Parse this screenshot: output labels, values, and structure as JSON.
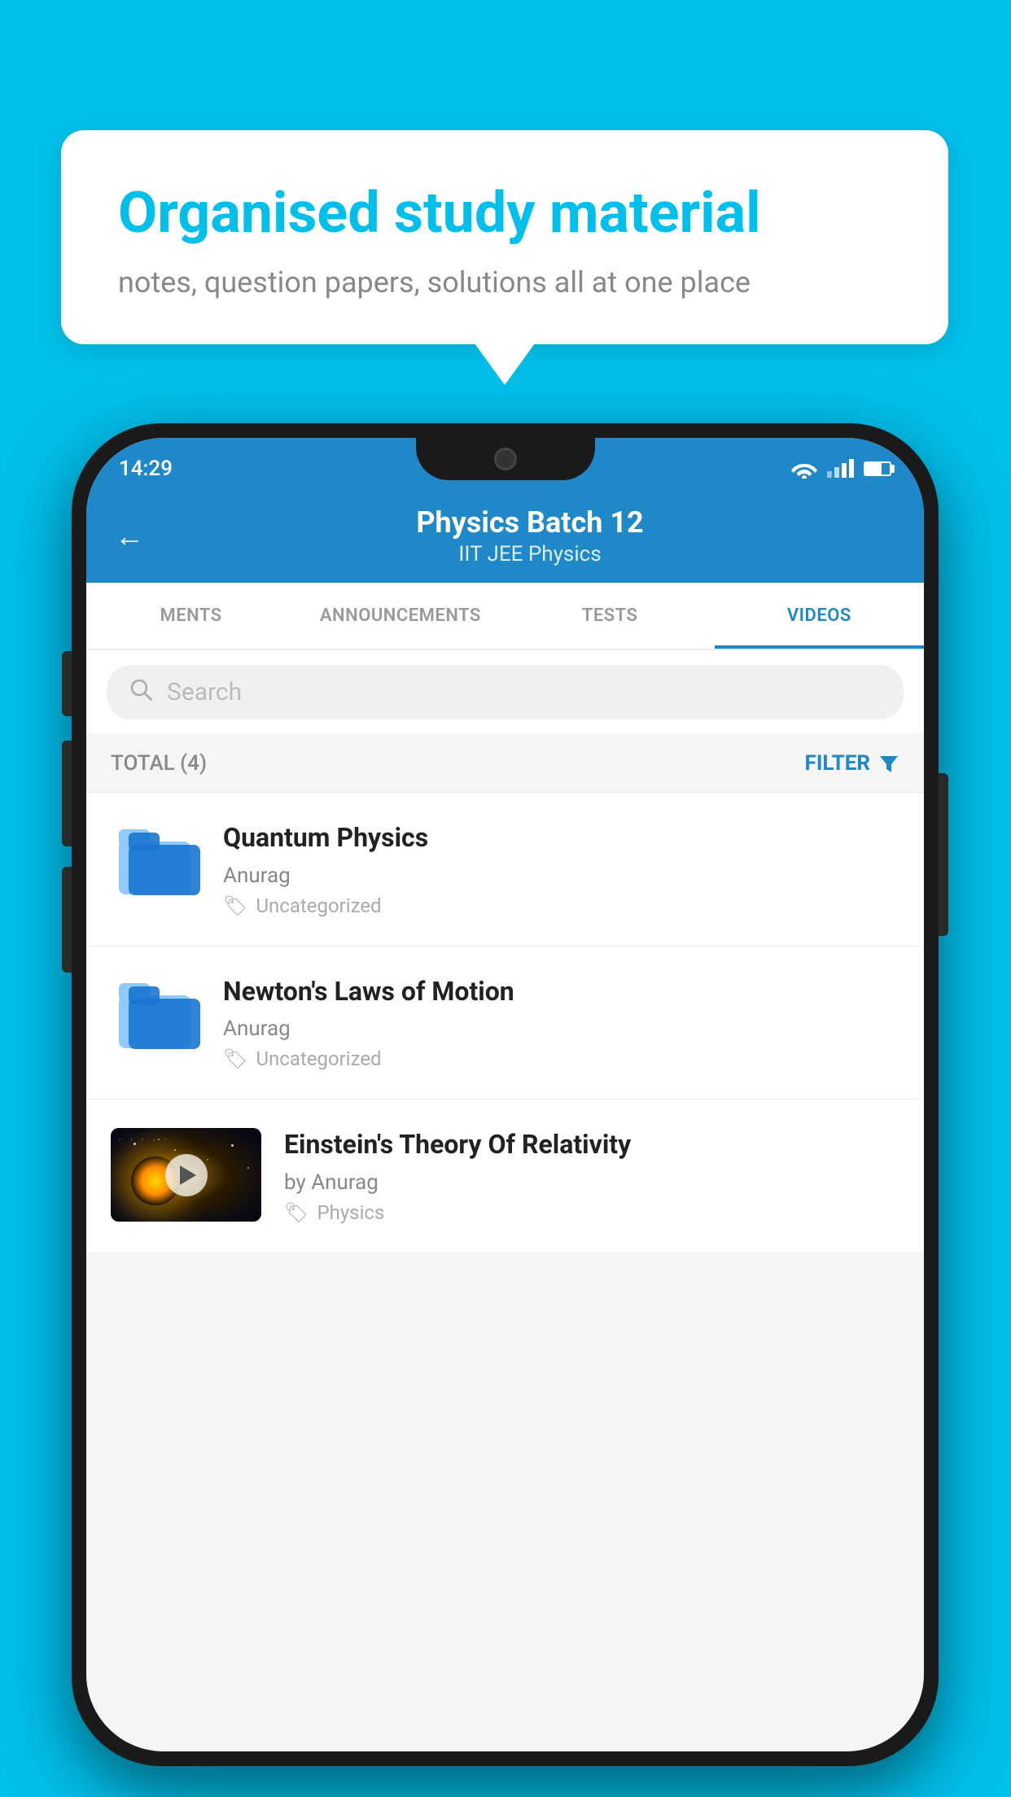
{
  "background_color": "#00BFEA",
  "bubble": {
    "title": "Organised study material",
    "subtitle": "notes, question papers, solutions all at one place"
  },
  "status_bar": {
    "time": "14:29",
    "icons": [
      "wifi",
      "signal",
      "battery"
    ]
  },
  "header": {
    "back_label": "←",
    "title": "Physics Batch 12",
    "subtitle": "IIT JEE   Physics"
  },
  "tabs": [
    {
      "label": "MENTS",
      "active": false
    },
    {
      "label": "ANNOUNCEMENTS",
      "active": false
    },
    {
      "label": "TESTS",
      "active": false
    },
    {
      "label": "VIDEOS",
      "active": true
    }
  ],
  "search": {
    "placeholder": "Search"
  },
  "filter_bar": {
    "total_label": "TOTAL (4)",
    "filter_label": "FILTER"
  },
  "videos": [
    {
      "id": "quantum",
      "title": "Quantum Physics",
      "author": "Anurag",
      "tag": "Uncategorized",
      "type": "folder"
    },
    {
      "id": "newton",
      "title": "Newton's Laws of Motion",
      "author": "Anurag",
      "tag": "Uncategorized",
      "type": "folder"
    },
    {
      "id": "einstein",
      "title": "Einstein's Theory Of Relativity",
      "author": "by Anurag",
      "tag": "Physics",
      "type": "video"
    }
  ]
}
